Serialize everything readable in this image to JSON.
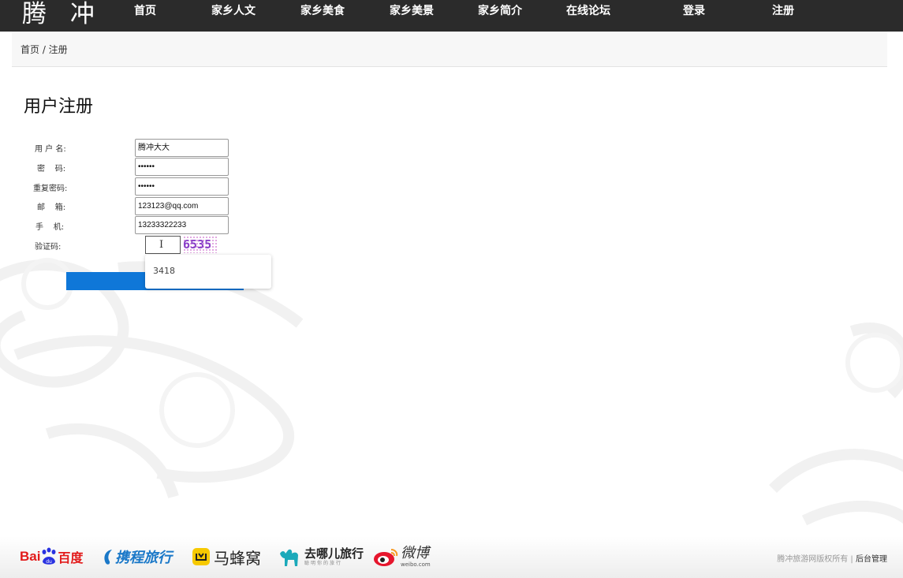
{
  "header": {
    "logo": "腾 冲",
    "nav": [
      {
        "label": "首页"
      },
      {
        "label": "家乡人文"
      },
      {
        "label": "家乡美食"
      },
      {
        "label": "家乡美景"
      },
      {
        "label": "家乡简介"
      },
      {
        "label": "在线论坛"
      },
      {
        "label": "登录"
      },
      {
        "label": "注册"
      }
    ]
  },
  "breadcrumb": "首页 / 注册",
  "page_title": "用户注册",
  "form": {
    "username": {
      "label": "用 户 名:",
      "value": "腾冲大大"
    },
    "password": {
      "label": "密    码:",
      "value": "••••••"
    },
    "confirm_password": {
      "label": "重复密码:",
      "value": "••••••"
    },
    "email": {
      "label": "邮    箱:",
      "value": "123123@qq.com"
    },
    "phone": {
      "label": "手    机:",
      "value": "13233322233"
    },
    "captcha": {
      "label": "验证码:",
      "value": "",
      "image_text": "6535"
    }
  },
  "autocomplete": {
    "suggestion": "3418"
  },
  "footer": {
    "partners": {
      "baidu": {
        "prefix": "Bai",
        "suffix": "百度"
      },
      "ctrip": "携程旅行",
      "mafengwo": "马蜂窝",
      "qunar": {
        "name": "去哪儿旅行",
        "tagline": "聪明你的旅行"
      },
      "weibo": {
        "name": "微博",
        "domain": "weibo.com"
      }
    },
    "copyright": "腾冲旅游网版权所有 |",
    "admin_link": "后台管理"
  },
  "colors": {
    "topbar": "#2b2b2b",
    "submit": "#0f77d8",
    "baidu_red": "#e21a1a",
    "baidu_blue": "#2932e1",
    "ctrip_blue": "#1a78c8",
    "mafengwo_yellow": "#f7c900",
    "qunar_teal": "#1ba9ba",
    "weibo_red": "#e6162d"
  }
}
